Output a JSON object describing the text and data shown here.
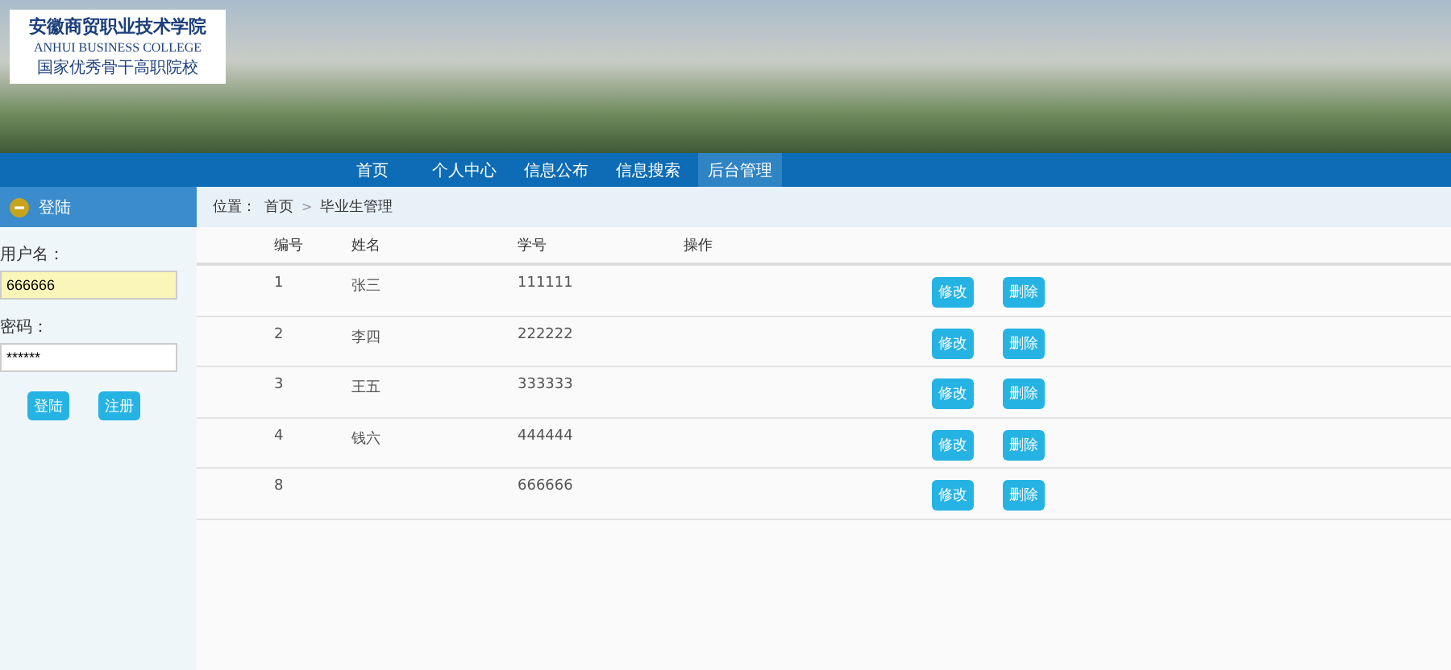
{
  "logo": {
    "title": "安徽商贸职业技术学院",
    "subtitle": "ANHUI BUSINESS COLLEGE",
    "slogan": "国家优秀骨干高职院校"
  },
  "nav": [
    {
      "label": "首页",
      "selected": false
    },
    {
      "label": "个人中心",
      "selected": false
    },
    {
      "label": "信息公布",
      "selected": false
    },
    {
      "label": "信息搜索",
      "selected": false
    },
    {
      "label": "后台管理",
      "selected": true
    }
  ],
  "sidebar": {
    "title": "登陆",
    "username_label": "用户名：",
    "username": "666666",
    "password_label": "密码：",
    "password": "******",
    "buttons": [
      "登陆",
      "注册"
    ]
  },
  "breadcrumb": {
    "prefix": "位置：",
    "items": [
      "首页",
      "毕业生管理"
    ],
    "separator": ">"
  },
  "table": {
    "columns": [
      "编号",
      "姓名",
      "学号",
      "操作"
    ],
    "rows": [
      {
        "id": "1",
        "name": "张三",
        "number": "111111",
        "actions": [
          "修改",
          "删除"
        ]
      },
      {
        "id": "2",
        "name": "李四",
        "number": "222222",
        "actions": [
          "修改",
          "删除"
        ]
      },
      {
        "id": "3",
        "name": "王五",
        "number": "333333",
        "actions": [
          "修改",
          "删除"
        ]
      },
      {
        "id": "4",
        "name": "钱六",
        "number": "444444",
        "actions": [
          "修改",
          "删除"
        ]
      },
      {
        "id": "8",
        "name": "",
        "number": "666666",
        "actions": [
          "修改",
          "删除"
        ]
      }
    ]
  }
}
